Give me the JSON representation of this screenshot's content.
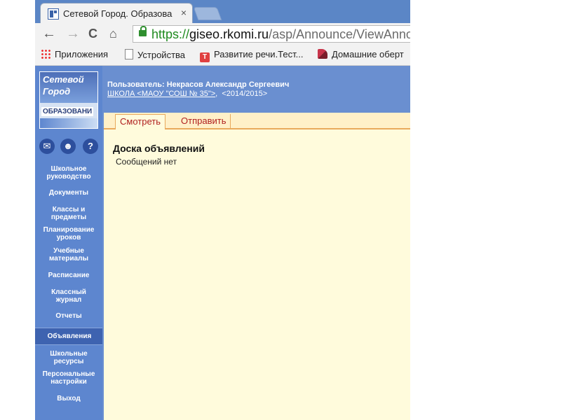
{
  "browser": {
    "tab_title": "Сетевой Город. Образова",
    "tab_close": "×",
    "url_scheme": "https://",
    "url_host": "giseo.rkomi.ru",
    "url_path": "/asp/Announce/ViewAnno",
    "nav": {
      "back": "←",
      "forward": "→",
      "reload": "C",
      "home": "⌂"
    }
  },
  "bookmarks": [
    {
      "label": "Приложения",
      "icon": "apps-icon"
    },
    {
      "label": "Устройства",
      "icon": "page-icon"
    },
    {
      "label": "Развитие речи.Тест...",
      "icon": "t-icon",
      "icon_text": "T"
    },
    {
      "label": "Домашние оберт",
      "icon": "shoe-icon"
    }
  ],
  "header": {
    "user_line": "Пользователь: Некрасов Александр Сергеевич",
    "school_link": "ШКОЛА <МАОУ \"СОШ № 35\">",
    "school_sep": ",",
    "year": "<2014/2015>"
  },
  "logo": {
    "line1": "Сетевой",
    "line2": "Город",
    "line3": "ОБРАЗОВАНИ"
  },
  "sidebar_icons": {
    "mail": "✉",
    "users": "☻",
    "help": "?"
  },
  "sidebar": [
    {
      "label": "Школьное руководство"
    },
    {
      "label": "Документы"
    },
    {
      "label": "Классы и предметы"
    },
    {
      "label": "Планирование уроков"
    },
    {
      "label": "Учебные материалы"
    },
    {
      "label": "Расписание"
    },
    {
      "label": "Классный журнал"
    },
    {
      "label": "Отчеты"
    },
    {
      "label": "Объявления",
      "active": true
    },
    {
      "label": "Школьные ресурсы"
    },
    {
      "label": "Персональные настройки"
    },
    {
      "label": "Выход"
    }
  ],
  "tabs": [
    {
      "label": "Смотреть",
      "selected": true
    },
    {
      "label": "Отправить",
      "selected": false
    }
  ],
  "content": {
    "title": "Доска объявлений",
    "message": "Сообщений нет"
  },
  "colors": {
    "header_blue": "#6a8fd0",
    "sidebar_blue": "#5d86cf",
    "page_bg": "#fffbdc",
    "tab_red": "#b02020"
  }
}
